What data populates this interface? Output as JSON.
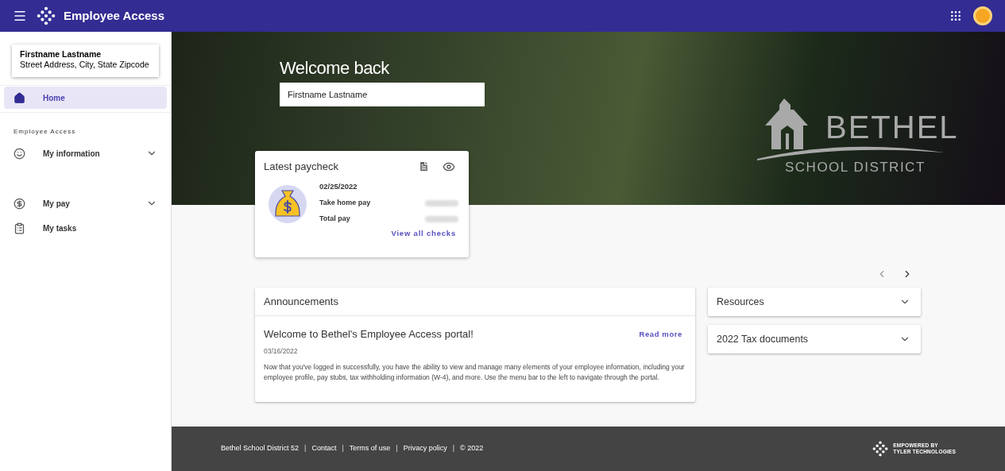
{
  "app_bar": {
    "title": "Employee Access"
  },
  "profile": {
    "name": "Firstname Lastname",
    "address": "Street Address, City, State  Zipcode"
  },
  "sidebar": {
    "top_items": [
      {
        "kind": "home",
        "label": "Home",
        "selected": true
      }
    ],
    "section_label": "Employee Access",
    "items": [
      {
        "kind": "info",
        "label": "My information",
        "selected": false,
        "expandable": true
      },
      {
        "kind": "pay",
        "label": "My pay",
        "selected": false,
        "expandable": true
      },
      {
        "kind": "tasks",
        "label": "My tasks",
        "selected": false,
        "expandable": false
      }
    ]
  },
  "hero": {
    "heading": "Welcome back",
    "name": "Firstname Lastname",
    "logo": {
      "name": "BETHEL",
      "subtitle": "SCHOOL DISTRICT"
    }
  },
  "paycheck": {
    "title": "Latest paycheck",
    "date": "02/25/2022",
    "rows": [
      {
        "label": "Take home pay"
      },
      {
        "label": "Total pay"
      }
    ],
    "link": "View all checks"
  },
  "announcements": {
    "title": "Announcements",
    "items": [
      {
        "title": "Welcome to Bethel's Employee Access portal!",
        "link": "Read more",
        "date": "03/16/2022",
        "body": "Now that you've logged in successfully, you have the ability to view and manage many elements of your employee information, including your employee profile, pay stubs, tax withholding information (W-4), and more. Use the menu bar to the left to navigate through the portal."
      }
    ]
  },
  "panels": [
    {
      "title": "Resources",
      "expanded": false
    },
    {
      "title": "2022 Tax documents",
      "expanded": false
    }
  ],
  "footer": {
    "links": [
      {
        "kind": "link",
        "text": "Bethel School District 52"
      },
      {
        "kind": "separator",
        "text": "|"
      },
      {
        "kind": "link",
        "text": "Contact"
      },
      {
        "kind": "separator",
        "text": "|"
      },
      {
        "kind": "link",
        "text": "Terms of use"
      },
      {
        "kind": "separator",
        "text": "|"
      },
      {
        "kind": "link",
        "text": "Privacy policy"
      },
      {
        "kind": "separator",
        "text": "|"
      },
      {
        "kind": "link",
        "text": "© 2022"
      }
    ],
    "badge": [
      "EMPOWERED BY",
      "TYLER TECHNOLOGIES"
    ]
  }
}
